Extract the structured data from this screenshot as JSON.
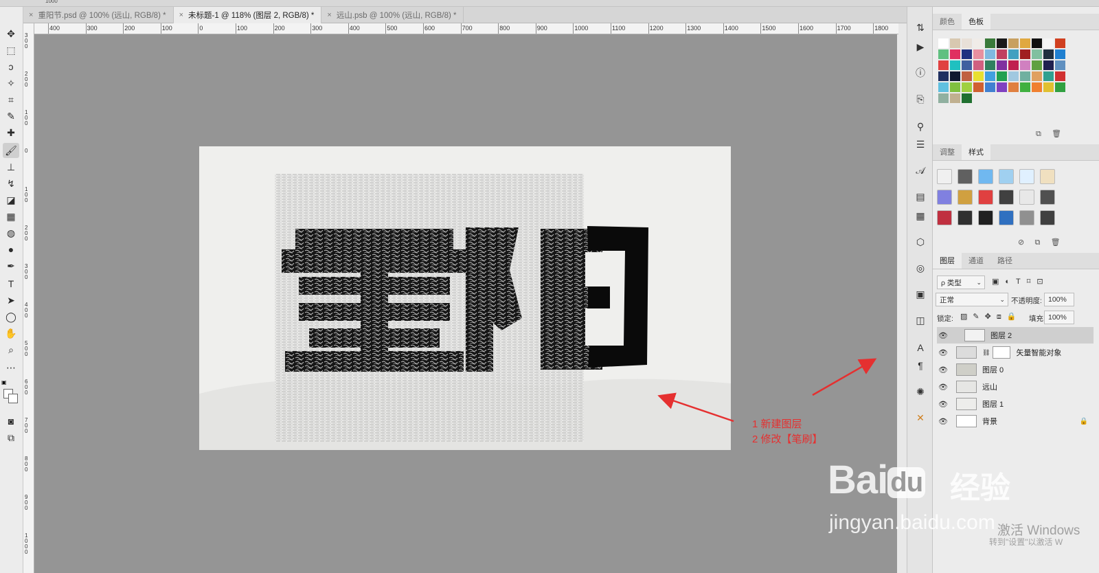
{
  "topstrip": {
    "zoom_hint": "1000"
  },
  "tabs": [
    {
      "label": "重阳节.psd @ 100% (远山, RGB/8) *"
    },
    {
      "label": "未标题-1 @ 118% (图层 2, RGB/8) *"
    },
    {
      "label": "远山.psb @ 100% (远山, RGB/8) *"
    }
  ],
  "tab_close_glyph": "×",
  "ruler_top_labels": [
    "400",
    "300",
    "200",
    "100",
    "0",
    "100",
    "200",
    "300",
    "400",
    "500",
    "600",
    "700",
    "800",
    "900",
    "1000",
    "1100",
    "1200",
    "1300",
    "1400",
    "1500",
    "1600",
    "1700",
    "1800"
  ],
  "ruler_left_labels": [
    "300",
    "200",
    "100",
    "0",
    "100",
    "200",
    "300",
    "400",
    "500",
    "600",
    "700",
    "800",
    "900",
    "1000"
  ],
  "canvas": {
    "title_chars": "重阳",
    "annotation_line1": "1 新建图层",
    "annotation_line2": "2 修改【笔刷】",
    "arrow_color": "#e53030"
  },
  "color_panel": {
    "tabs": [
      "颜色",
      "色板"
    ],
    "swatches": [
      "#ffffff",
      "#d8c8b0",
      "#e8e0d8",
      "#f0ece8",
      "#3a7a3a",
      "#1a1a1a",
      "#c8a060",
      "#e0a840",
      "#101010",
      "#f5f5f5",
      "#d04020",
      "#60c080",
      "#e03060",
      "#203080",
      "#e890a0",
      "#80b8e0",
      "#c04060",
      "#40a0c0",
      "#a02020",
      "#80c0a0",
      "#203040",
      "#2080d0",
      "#e04040",
      "#20c0c0",
      "#4060a0",
      "#d06080",
      "#308060",
      "#8030a0",
      "#c02050",
      "#d080c0",
      "#60a040",
      "#202050",
      "#6090c0",
      "#203060",
      "#101830",
      "#c06040",
      "#e8e030",
      "#40a0e0",
      "#20a050",
      "#a0c8e0",
      "#70b0a0",
      "#e0a060",
      "#30a090",
      "#d03030",
      "#60c0e0",
      "#80c040",
      "#a0d040",
      "#d06030",
      "#4080d0",
      "#8040c0",
      "#e08040",
      "#40b040",
      "#f08030",
      "#e0c030",
      "#30a040",
      "#90b0a0",
      "#c0b090",
      "#207030"
    ]
  },
  "styles_panel": {
    "tabs": [
      "调整",
      "样式"
    ],
    "swatch_colors": [
      "#f0f0f0",
      "#606060",
      "#70b8f0",
      "#a0d0f0",
      "#e0f0ff",
      "#f0e0c0",
      "#8080e0",
      "#d0a040",
      "#e04040",
      "#404040",
      "#e8e8e8",
      "#505050",
      "#c03040",
      "#303030",
      "#202020",
      "#3070c0",
      "#909090",
      "#404040"
    ]
  },
  "layers_panel": {
    "tabs": [
      "图层",
      "通道",
      "路径"
    ],
    "filter_label": "ρ 类型",
    "blend_mode": "正常",
    "opacity_label": "不透明度:",
    "opacity_value": "100%",
    "lock_label": "锁定:",
    "fill_label": "填充:",
    "fill_value": "100%",
    "layers": [
      {
        "name": "图层 2",
        "selected": true
      },
      {
        "name": "矢量智能对象",
        "selected": false
      },
      {
        "name": "图层 0",
        "selected": false
      },
      {
        "name": "远山",
        "selected": false
      },
      {
        "name": "图层 1",
        "selected": false
      },
      {
        "name": "背景",
        "selected": false,
        "locked": true
      }
    ]
  },
  "watermark": {
    "brand": "Bai",
    "brand_du": "du",
    "jingyan": "经验",
    "url": "jingyan.baidu.com"
  },
  "activation": {
    "line1": "激活 Windows",
    "line2": "转到\"设置\"以激活 W"
  }
}
